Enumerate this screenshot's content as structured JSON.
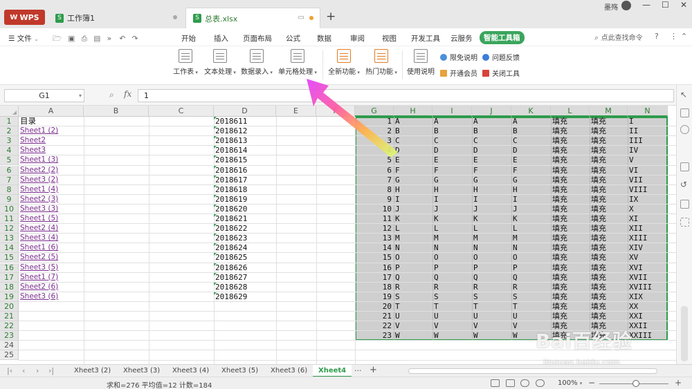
{
  "titlebar": {
    "brand": "WPS",
    "tabs": [
      {
        "name": "工作簿1"
      },
      {
        "name": "总表.xlsx",
        "active": true
      }
    ],
    "user": "墨殇",
    "win_min": "—",
    "win_max": "☐",
    "win_close": "✕"
  },
  "menu": {
    "file": "文件",
    "items": [
      "开始",
      "插入",
      "页面布局",
      "公式",
      "数据",
      "审阅",
      "视图",
      "开发工具",
      "云服务",
      "智能工具箱"
    ],
    "active_index": 9,
    "search": "点此查找命令"
  },
  "ribbon": {
    "big_buttons": [
      "工作表",
      "文本处理",
      "数据录入",
      "单元格处理",
      "全新功能",
      "热门功能",
      "使用说明"
    ],
    "small_buttons": [
      "限免说明",
      "问题反馈",
      "开通会员",
      "关闭工具"
    ]
  },
  "formula_bar": {
    "name_box": "G1",
    "fx": "fx",
    "value": "1"
  },
  "sheet": {
    "columns": [
      "A",
      "B",
      "C",
      "D",
      "E",
      "F",
      "G",
      "H",
      "I",
      "J",
      "K",
      "L",
      "M",
      "N"
    ],
    "selected_columns": [
      "G",
      "H",
      "I",
      "J",
      "K",
      "L",
      "M",
      "N"
    ],
    "col_a": [
      "目录",
      "Sheet1 (2)",
      "Sheet2",
      "Sheet3",
      "Sheet1 (3)",
      "Sheet2 (2)",
      "Sheet3 (2)",
      "Sheet1 (4)",
      "Sheet2 (3)",
      "Sheet3 (3)",
      "Sheet1 (5)",
      "Sheet2 (4)",
      "Sheet3 (4)",
      "Sheet1 (6)",
      "Sheet2 (5)",
      "Sheet3 (5)",
      "Sheet1 (7)",
      "Sheet2 (6)",
      "Sheet3 (6)"
    ],
    "col_d": [
      "2018611",
      "2018612",
      "2018613",
      "2018614",
      "2018615",
      "2018616",
      "2018617",
      "2018618",
      "2018619",
      "2018620",
      "2018621",
      "2018622",
      "2018623",
      "2018624",
      "2018625",
      "2018626",
      "2018627",
      "2018628",
      "2018629"
    ],
    "col_g": [
      "1",
      "2",
      "3",
      "4",
      "5",
      "6",
      "7",
      "8",
      "9",
      "10",
      "11",
      "12",
      "13",
      "14",
      "15",
      "16",
      "17",
      "18",
      "19",
      "20",
      "21",
      "22",
      "23"
    ],
    "letters": [
      "A",
      "B",
      "C",
      "D",
      "E",
      "F",
      "G",
      "H",
      "I",
      "J",
      "K",
      "L",
      "M",
      "N",
      "O",
      "P",
      "Q",
      "R",
      "S",
      "T",
      "U",
      "V",
      "W"
    ],
    "fill_text": "填充",
    "roman": [
      "I",
      "II",
      "III",
      "IV",
      "V",
      "VI",
      "VII",
      "VIII",
      "IX",
      "X",
      "XI",
      "XII",
      "XIII",
      "XIV",
      "XV",
      "XVI",
      "XVII",
      "XVIII",
      "XIX",
      "XX",
      "XXI",
      "XXII",
      "XXIII"
    ],
    "row_count": 25
  },
  "sheet_tabs": {
    "tabs": [
      "Xheet3 (2)",
      "Xheet3 (3)",
      "Xheet3 (4)",
      "Xheet3 (5)",
      "Xheet3 (6)",
      "Xheet4"
    ],
    "active_index": 5,
    "more": "···",
    "add": "+"
  },
  "status": {
    "text": "求和=276  平均值=12  计数=184",
    "zoom": "100%",
    "zoom_level_percent": 100
  },
  "watermark": {
    "main": "Bai百经验",
    "sub": "jingyan.baidu.com"
  },
  "colors": {
    "accent": "#3ba55c",
    "selection": "#2e9c4c",
    "link": "#7b2d8e",
    "wps_red": "#c0392b"
  }
}
